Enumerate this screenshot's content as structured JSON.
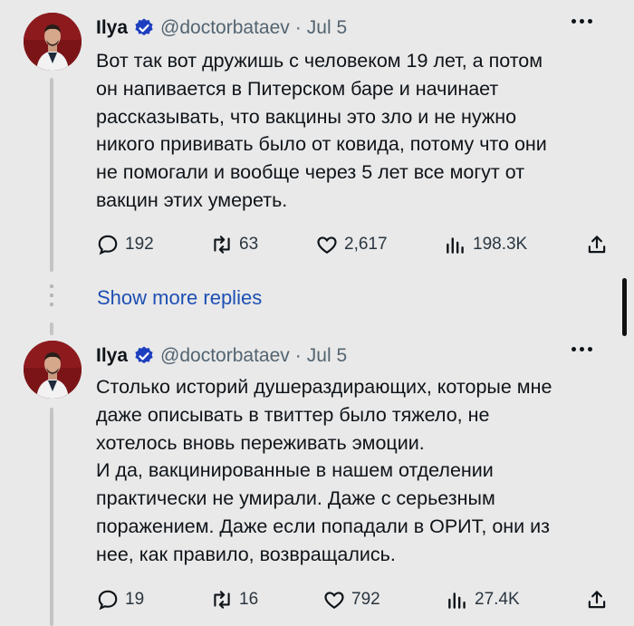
{
  "tweets": [
    {
      "name": "Ilya",
      "handle": "@doctorbataev",
      "separator": "·",
      "date": "Jul 5",
      "text": "Вот так вот дружишь с человеком 19 лет, а потом\nон напивается в Питерском баре и начинает\nрассказывать, что вакцины это зло и не нужно\nникого прививать было от ковида, потому что они\nне помогали и вообще через 5 лет все могут от\nвакцин этих умереть.",
      "replies": "192",
      "reposts": "63",
      "likes": "2,617",
      "views": "198.3K"
    },
    {
      "name": "Ilya",
      "handle": "@doctorbataev",
      "separator": "·",
      "date": "Jul 5",
      "text": "Столько историй душераздирающих, которые мне\nдаже описывать в твиттер было тяжело, не\nхотелось вновь переживать эмоции.\nИ да, вакцинированные в нашем отделении\nпрактически не умирали. Даже с серьезным\nпоражением. Даже если попадали в ОРИТ, они из\nнее, как правило, возвращались.",
      "replies": "19",
      "reposts": "16",
      "likes": "792",
      "views": "27.4K"
    }
  ],
  "show_more_replies": "Show more replies",
  "colors": {
    "background": "#e9e9e9",
    "link": "#1d4fb3",
    "verified": "#1d3fbf",
    "muted": "#536471"
  },
  "icons": [
    "reply-icon",
    "repost-icon",
    "like-icon",
    "views-icon",
    "share-icon",
    "verified-badge-icon",
    "more-options-icon"
  ]
}
